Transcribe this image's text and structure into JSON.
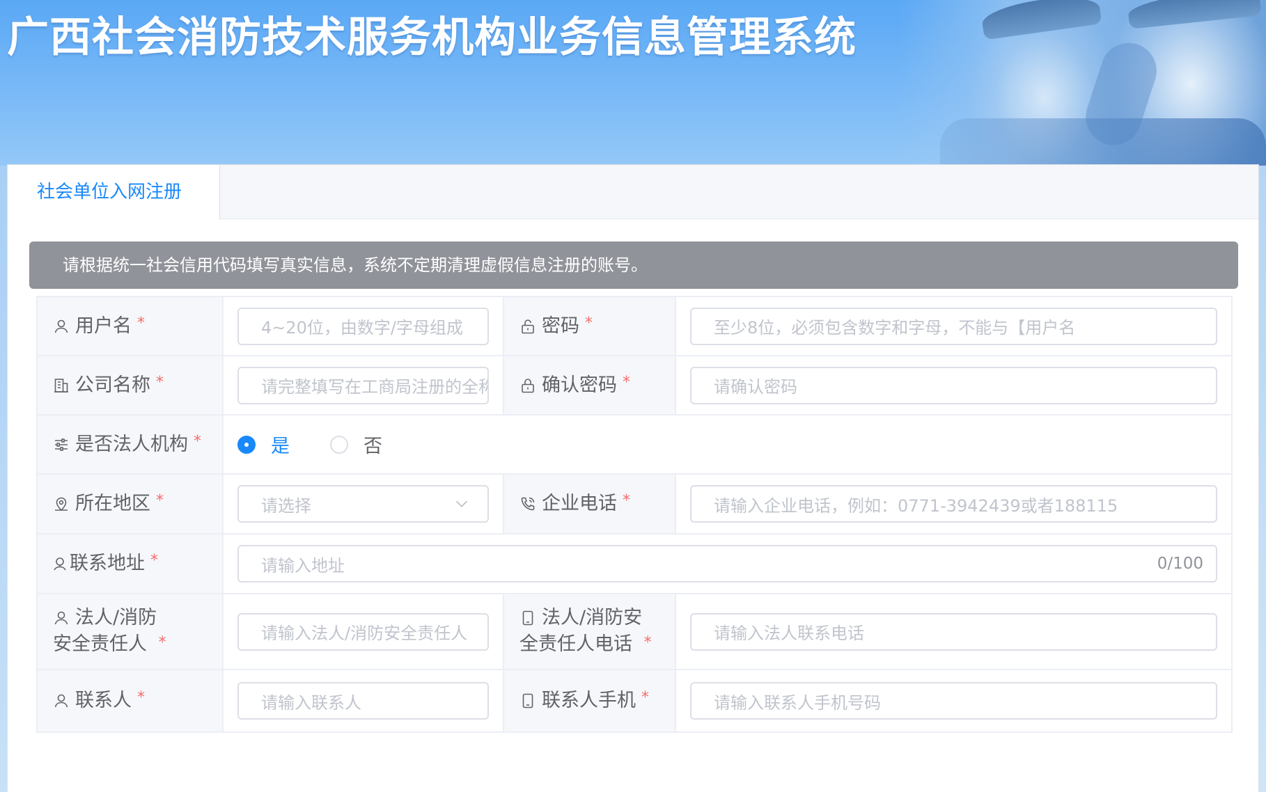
{
  "header": {
    "title": "广西社会消防技术服务机构业务信息管理系统"
  },
  "tabs": [
    {
      "label": "社会单位入网注册",
      "active": true
    }
  ],
  "notice": "请根据统一社会信用代码填写真实信息，系统不定期清理虚假信息注册的账号。",
  "required_mark": "*",
  "form": {
    "username": {
      "label": "用户名",
      "icon": "user-icon",
      "placeholder": "4~20位，由数字/字母组成"
    },
    "password": {
      "label": "密码",
      "icon": "lock-icon",
      "placeholder": "至少8位，必须包含数字和字母，不能与【用户名"
    },
    "company_name": {
      "label": "公司名称",
      "icon": "building-icon",
      "placeholder": "请完整填写在工商局注册的全称"
    },
    "confirm_password": {
      "label": "确认密码",
      "icon": "lock-icon",
      "placeholder": "请确认密码"
    },
    "is_legal_entity": {
      "label": "是否法人机构",
      "icon": "sliders-icon",
      "options": [
        "是",
        "否"
      ],
      "selected": "是"
    },
    "region": {
      "label": "所在地区",
      "icon": "location-icon",
      "placeholder": "请选择"
    },
    "company_phone": {
      "label": "企业电话",
      "icon": "phone-icon",
      "placeholder": "请输入企业电话，例如：0771-3942439或者188115"
    },
    "address": {
      "label": "联系地址",
      "icon": "location-pin-icon",
      "placeholder": "请输入地址",
      "counter": "0/100"
    },
    "legal_person": {
      "label_line1": "法人/消防",
      "label_line2": "安全责任人",
      "icon": "user-icon",
      "placeholder": "请输入法人/消防安全责任人"
    },
    "legal_person_phone": {
      "label_line1": "法人/消防安",
      "label_line2": "全责任人电话",
      "icon": "mobile-icon",
      "placeholder": "请输入法人联系电话"
    },
    "contact": {
      "label": "联系人",
      "icon": "user-icon",
      "placeholder": "请输入联系人"
    },
    "contact_mobile": {
      "label": "联系人手机",
      "icon": "mobile-icon",
      "placeholder": "请输入联系人手机号码"
    }
  },
  "colors": {
    "primary": "#1989fa",
    "required": "#f56c6c",
    "notice_bg": "#909399",
    "label_bg": "#f5f7fa",
    "placeholder": "#c0c4cc"
  }
}
